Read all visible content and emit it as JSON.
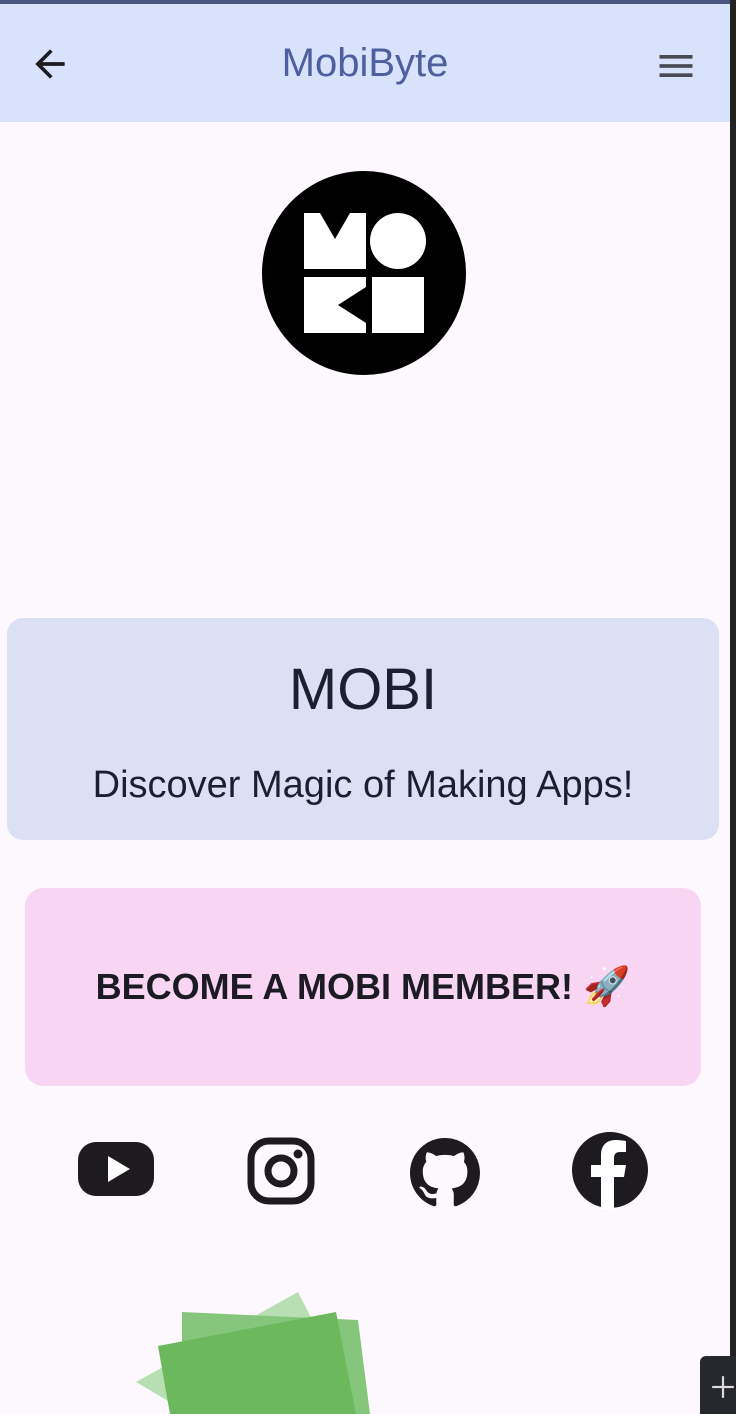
{
  "appbar": {
    "title": "MobiByte"
  },
  "hero": {
    "title": "MOBI",
    "subtitle": "Discover Magic of Making Apps!"
  },
  "cta": {
    "label": "BECOME A MOBI MEMBER!",
    "emoji": "🚀"
  },
  "socials": [
    {
      "name": "youtube-icon"
    },
    {
      "name": "instagram-icon"
    },
    {
      "name": "github-icon"
    },
    {
      "name": "facebook-icon"
    }
  ],
  "colors": {
    "appbar_bg": "#d9e2fb",
    "title_color": "#4d5f9c",
    "hero_bg": "#dbe0f4",
    "cta_bg": "#f8d6f3",
    "background": "#fdf8fd"
  }
}
